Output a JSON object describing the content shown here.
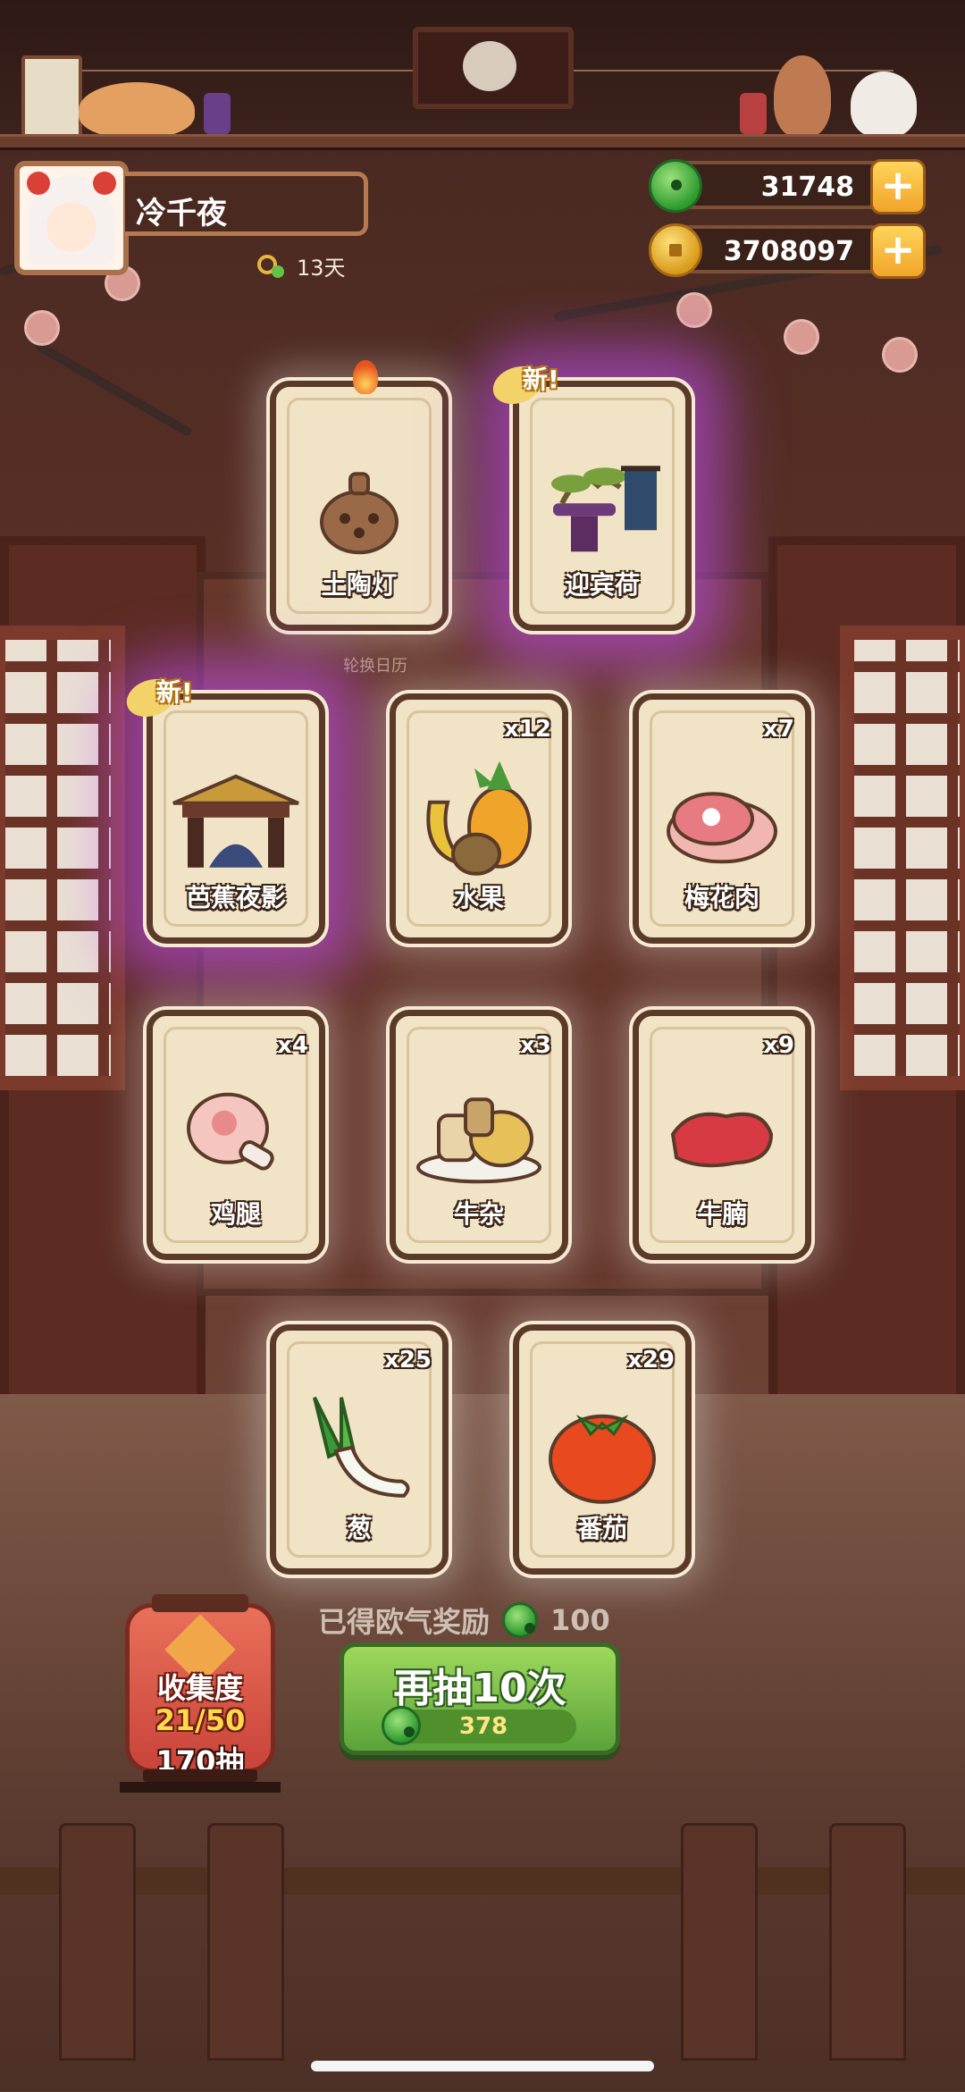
{
  "player": {
    "name": "冷千夜",
    "days_label": "13天"
  },
  "currency": {
    "jade": "31748",
    "coins": "3708097"
  },
  "hint_label": "轮换日历",
  "cards": [
    {
      "label": "土陶灯",
      "qty": "",
      "is_new": false,
      "icon": "clay-lamp-icon"
    },
    {
      "label": "迎宾荷",
      "qty": "",
      "is_new": true,
      "icon": "bonsai-display-icon"
    },
    {
      "label": "芭蕉夜影",
      "qty": "",
      "is_new": true,
      "icon": "pavilion-gate-icon"
    },
    {
      "label": "水果",
      "qty": "x12",
      "is_new": false,
      "icon": "fruit-icon"
    },
    {
      "label": "梅花肉",
      "qty": "x7",
      "is_new": false,
      "icon": "pork-icon"
    },
    {
      "label": "鸡腿",
      "qty": "x4",
      "is_new": false,
      "icon": "drumstick-icon"
    },
    {
      "label": "牛杂",
      "qty": "x3",
      "is_new": false,
      "icon": "beef-offal-icon"
    },
    {
      "label": "牛腩",
      "qty": "x9",
      "is_new": false,
      "icon": "beef-brisket-icon"
    },
    {
      "label": "葱",
      "qty": "x25",
      "is_new": false,
      "icon": "scallion-icon"
    },
    {
      "label": "番茄",
      "qty": "x29",
      "is_new": false,
      "icon": "tomato-icon"
    }
  ],
  "new_badge": "新!",
  "reward": {
    "label": "已得欧气奖励",
    "value": "100"
  },
  "redraw_button": {
    "label": "再抽10次",
    "cost": "378"
  },
  "collection": {
    "title": "收集度",
    "progress": "21/50",
    "draws": "170抽"
  },
  "colors": {
    "button_green": "#5aa33a",
    "rare_glow": "#c850ff",
    "card_bg": "#f1e3c6"
  }
}
